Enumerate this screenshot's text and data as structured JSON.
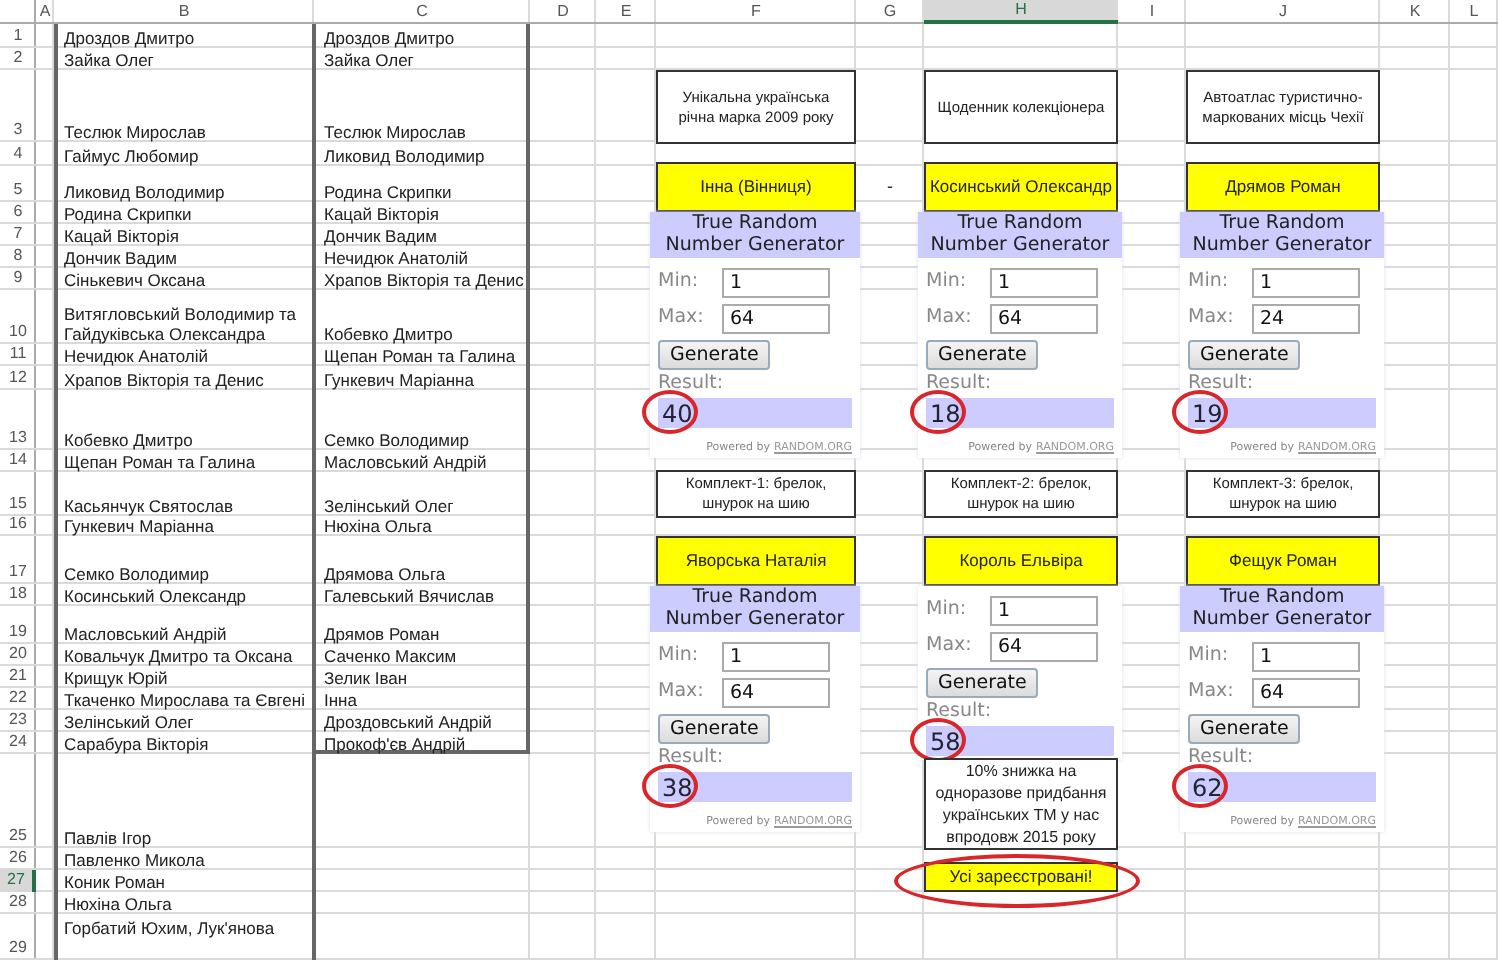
{
  "columns": [
    {
      "label": "A",
      "selected": false
    },
    {
      "label": "B",
      "selected": false
    },
    {
      "label": "C",
      "selected": false
    },
    {
      "label": "D",
      "selected": false
    },
    {
      "label": "E",
      "selected": false
    },
    {
      "label": "F",
      "selected": false
    },
    {
      "label": "G",
      "selected": false
    },
    {
      "label": "H",
      "selected": true
    },
    {
      "label": "I",
      "selected": false
    },
    {
      "label": "J",
      "selected": false
    },
    {
      "label": "K",
      "selected": false
    },
    {
      "label": "L",
      "selected": false
    }
  ],
  "rows": [
    {
      "number": "1",
      "selected": false,
      "b": "Дроздов Дмитро",
      "c": "Дроздов Дмитро"
    },
    {
      "number": "2",
      "selected": false,
      "b": "Зайка Олег",
      "c": "Зайка Олег"
    },
    {
      "number": "3",
      "selected": false,
      "b": "Теслюк Мирослав",
      "c": "Теслюк Мирослав"
    },
    {
      "number": "4",
      "selected": false,
      "b": "Гаймус Любомир",
      "c": "Ликовид Володимир"
    },
    {
      "number": "5",
      "selected": false,
      "b": "Ликовид Володимир",
      "c": "Родина Скрипки"
    },
    {
      "number": "6",
      "selected": false,
      "b": "Родина Скрипки",
      "c": "Кацай Вікторія"
    },
    {
      "number": "7",
      "selected": false,
      "b": "Кацай Вікторія",
      "c": "Дончик Вадим"
    },
    {
      "number": "8",
      "selected": false,
      "b": "Дончик Вадим",
      "c": "Нечидюк Анатолій"
    },
    {
      "number": "9",
      "selected": false,
      "b": "Сінькевич Оксана",
      "c": "Храпов Вікторія та Денис"
    },
    {
      "number": "10",
      "selected": false,
      "b": "Витягловський Володимир та Гайдуківська Олександра",
      "c": "Кобевко Дмитро"
    },
    {
      "number": "11",
      "selected": false,
      "b": "Нечидюк Анатолій",
      "c": "Щепан Роман та Галина"
    },
    {
      "number": "12",
      "selected": false,
      "b": "Храпов Вікторія та Денис",
      "c": "Гункевич Маріанна"
    },
    {
      "number": "13",
      "selected": false,
      "b": "Кобевко Дмитро",
      "c": "Семко Володимир"
    },
    {
      "number": "14",
      "selected": false,
      "b": "Щепан Роман та Галина",
      "c": "Масловський Андрій"
    },
    {
      "number": "15",
      "selected": false,
      "b": "Касьянчук Святослав",
      "c": "Зелінський Олег"
    },
    {
      "number": "16",
      "selected": false,
      "b": "Гункевич Маріанна",
      "c": "Нюхіна Ольга"
    },
    {
      "number": "17",
      "selected": false,
      "b": "Семко Володимир",
      "c": "Дрямова Ольга"
    },
    {
      "number": "18",
      "selected": false,
      "b": "Косинський Олександр",
      "c": "Галевський Вячислав"
    },
    {
      "number": "19",
      "selected": false,
      "b": "Масловський Андрій",
      "c": "Дрямов Роман"
    },
    {
      "number": "20",
      "selected": false,
      "b": "Ковальчук Дмитро та Оксана",
      "c": "Саченко Максим"
    },
    {
      "number": "21",
      "selected": false,
      "b": "Крищук Юрій",
      "c": "Зелик Іван"
    },
    {
      "number": "22",
      "selected": false,
      "b": "Ткаченко Мирослава та Євгені",
      "c": "Інна"
    },
    {
      "number": "23",
      "selected": false,
      "b": "Зелінський Олег",
      "c": "Дроздовський Андрій"
    },
    {
      "number": "24",
      "selected": false,
      "b": "Сарабура Вікторія",
      "c": "Прокоф'єв Андрій"
    },
    {
      "number": "25",
      "selected": false,
      "b": "Павлів Ігор"
    },
    {
      "number": "26",
      "selected": false,
      "b": "Павленко Микола"
    },
    {
      "number": "27",
      "selected": true,
      "b": "Коник Роман"
    },
    {
      "number": "28",
      "selected": false,
      "b": "Нюхіна Ольга"
    },
    {
      "number": "29",
      "selected": false,
      "b": "Горбатий Юхим, Лук'янова"
    }
  ],
  "separator": "-",
  "draws": [
    {
      "prize": "Унікальна українська річна марка 2009 року",
      "winner": "Інна (Вінниця)",
      "generator": {
        "title": "True Random Number Generator",
        "min_label": "Min:",
        "min": "1",
        "max_label": "Max:",
        "max": "64",
        "button": "Generate",
        "result_label": "Result:",
        "result": "40",
        "circled": true,
        "powered_by": "Powered by",
        "link": "RANDOM.ORG"
      }
    },
    {
      "prize": "Щоденник колекціонера",
      "winner": "Косинський Олександр",
      "generator": {
        "title": "True Random Number Generator",
        "min_label": "Min:",
        "min": "1",
        "max_label": "Max:",
        "max": "64",
        "button": "Generate",
        "result_label": "Result:",
        "result": "18",
        "circled": true,
        "powered_by": "Powered by",
        "link": "RANDOM.ORG"
      }
    },
    {
      "prize": "Автоатлас туристично-маркованих місць Чехії",
      "winner": "Дрямов Роман",
      "generator": {
        "title": "True Random Number Generator",
        "min_label": "Min:",
        "min": "1",
        "max_label": "Max:",
        "max": "24",
        "button": "Generate",
        "result_label": "Result:",
        "result": "19",
        "circled": true,
        "powered_by": "Powered by",
        "link": "RANDOM.ORG"
      }
    },
    {
      "prize": "Комплект-1: брелок, шнурок на шию",
      "winner": "Яворська Наталія",
      "generator": {
        "title": "True Random Number Generator",
        "min_label": "Min:",
        "min": "1",
        "max_label": "Max:",
        "max": "64",
        "button": "Generate",
        "result_label": "Result:",
        "result": "38",
        "circled": true,
        "powered_by": "Powered by",
        "link": "RANDOM.ORG"
      }
    },
    {
      "prize": "Комплект-2: брелок, шнурок на шию",
      "winner": "Король Ельвіра",
      "generator": {
        "min_label": "Min:",
        "min": "1",
        "max_label": "Max:",
        "max": "64",
        "button": "Generate",
        "result_label": "Result:",
        "result": "58",
        "circled": true
      }
    },
    {
      "prize": "Комплект-3: брелок, шнурок на шию",
      "winner": "Фещук Роман",
      "generator": {
        "title": "True Random Number Generator",
        "min_label": "Min:",
        "min": "1",
        "max_label": "Max:",
        "max": "64",
        "button": "Generate",
        "result_label": "Result:",
        "result": "62",
        "circled": true,
        "powered_by": "Powered by",
        "link": "RANDOM.ORG"
      }
    }
  ],
  "discount_note": "10% знижка на одноразове придбання українських ТМ у нас впродовж 2015 року",
  "status_banner": {
    "text": "Усі зареєстровані!",
    "circled": true
  }
}
